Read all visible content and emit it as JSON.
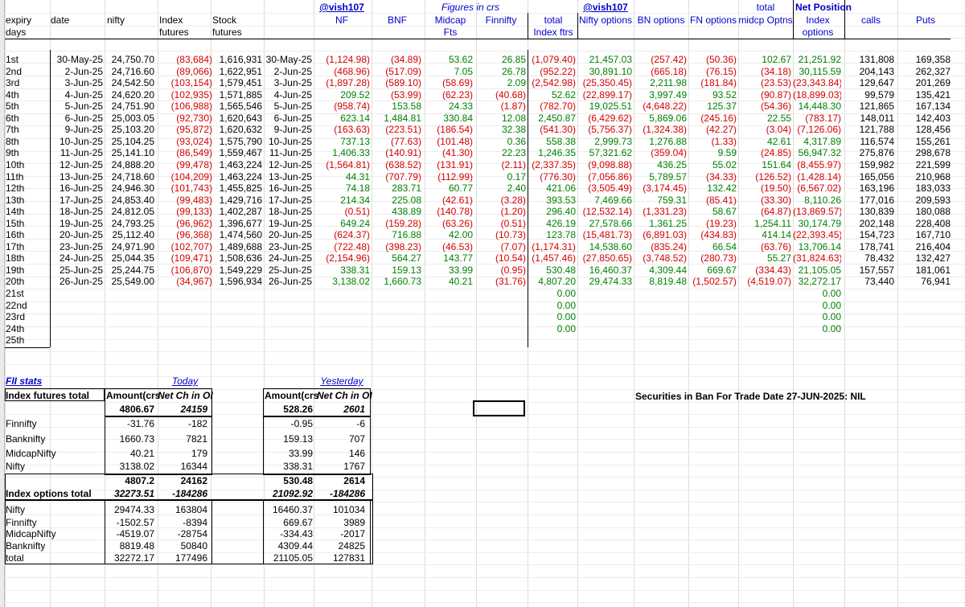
{
  "top_header": {
    "vish_left": "@vish107",
    "figures": "Figures in crs",
    "vish_right": "@vish107",
    "total_top": "total",
    "net_position": "Net Position"
  },
  "header_row": {
    "expiry": "expiry",
    "date": "date",
    "nifty": "nifty",
    "index_futures": "Index",
    "stock_futures": "Stock",
    "nf": "NF",
    "bnf": "BNF",
    "midcap": "Midcap",
    "finnifty": "Finnifty",
    "total": "total",
    "nifty_options": "Nifty options",
    "bn_options": "BN options",
    "fn_options": "FN options",
    "midcp_optns": "midcp Optns",
    "index": "Index",
    "calls": "calls",
    "puts": "Puts"
  },
  "header_row2": {
    "days": "days",
    "futures1": "futures",
    "futures2": "futures",
    "fts": "Fts",
    "index_ftrs": "Index ftrs",
    "options": "options"
  },
  "rows": [
    [
      "1st",
      "30-May-25",
      "24,750.70",
      "(83,684)",
      "1,616,931",
      "30-May-25",
      "(1,124.98)",
      "(34.89)",
      "53.62",
      "26.85",
      "(1,079.40)",
      "21,457.03",
      "(257.42)",
      "(50.36)",
      "102.67",
      "21,251.92",
      "131,808",
      "169,358"
    ],
    [
      "2nd",
      "2-Jun-25",
      "24,716.60",
      "(89,066)",
      "1,622,951",
      "2-Jun-25",
      "(468.96)",
      "(517.09)",
      "7.05",
      "26.78",
      "(952.22)",
      "30,891.10",
      "(665.18)",
      "(76.15)",
      "(34.18)",
      "30,115.59",
      "204,143",
      "262,327"
    ],
    [
      "3rd",
      "3-Jun-25",
      "24,542.50",
      "(103,154)",
      "1,579,451",
      "3-Jun-25",
      "(1,897.28)",
      "(589.10)",
      "(58.69)",
      "2.09",
      "(2,542.98)",
      "(25,350.45)",
      "2,211.98",
      "(181.84)",
      "(23.53)",
      "(23,343.84)",
      "129,647",
      "201,269"
    ],
    [
      "4th",
      "4-Jun-25",
      "24,620.20",
      "(102,935)",
      "1,571,885",
      "4-Jun-25",
      "209.52",
      "(53.99)",
      "(62.23)",
      "(40.68)",
      "52.62",
      "(22,899.17)",
      "3,997.49",
      "93.52",
      "(90.87)",
      "(18,899.03)",
      "99,579",
      "135,421"
    ],
    [
      "5th",
      "5-Jun-25",
      "24,751.90",
      "(106,988)",
      "1,565,546",
      "5-Jun-25",
      "(958.74)",
      "153.58",
      "24.33",
      "(1.87)",
      "(782.70)",
      "19,025.51",
      "(4,648.22)",
      "125.37",
      "(54.36)",
      "14,448.30",
      "121,865",
      "167,134"
    ],
    [
      "6th",
      "6-Jun-25",
      "25,003.05",
      "(92,730)",
      "1,620,643",
      "6-Jun-25",
      "623.14",
      "1,484.81",
      "330.84",
      "12.08",
      "2,450.87",
      "(6,429.62)",
      "5,869.06",
      "(245.16)",
      "22.55",
      "(783.17)",
      "148,011",
      "142,403"
    ],
    [
      "7th",
      "9-Jun-25",
      "25,103.20",
      "(95,872)",
      "1,620,632",
      "9-Jun-25",
      "(163.63)",
      "(223.51)",
      "(186.54)",
      "32.38",
      "(541.30)",
      "(5,756.37)",
      "(1,324.38)",
      "(42.27)",
      "(3.04)",
      "(7,126.06)",
      "121,788",
      "128,456"
    ],
    [
      "8th",
      "10-Jun-25",
      "25,104.25",
      "(93,024)",
      "1,575,790",
      "10-Jun-25",
      "737.13",
      "(77.63)",
      "(101.48)",
      "0.36",
      "558.38",
      "2,999.73",
      "1,276.88",
      "(1.33)",
      "42.61",
      "4,317.89",
      "116,574",
      "155,261"
    ],
    [
      "9th",
      "11-Jun-25",
      "25,141.10",
      "(86,549)",
      "1,559,467",
      "11-Jun-25",
      "1,406.33",
      "(140.91)",
      "(41.30)",
      "22.23",
      "1,246.35",
      "57,321.62",
      "(359.04)",
      "9.59",
      "(24.85)",
      "56,947.32",
      "275,876",
      "298,678"
    ],
    [
      "10th",
      "12-Jun-25",
      "24,888.20",
      "(99,478)",
      "1,463,224",
      "12-Jun-25",
      "(1,564.81)",
      "(638.52)",
      "(131.91)",
      "(2.11)",
      "(2,337.35)",
      "(9,098.88)",
      "436.25",
      "55.02",
      "151.64",
      "(8,455.97)",
      "159,982",
      "221,599"
    ],
    [
      "11th",
      "13-Jun-25",
      "24,718.60",
      "(104,209)",
      "1,463,224",
      "13-Jun-25",
      "44.31",
      "(707.79)",
      "(112.99)",
      "0.17",
      "(776.30)",
      "(7,056.86)",
      "5,789.57",
      "(34.33)",
      "(126.52)",
      "(1,428.14)",
      "165,056",
      "210,968"
    ],
    [
      "12th",
      "16-Jun-25",
      "24,946.30",
      "(101,743)",
      "1,455,825",
      "16-Jun-25",
      "74.18",
      "283.71",
      "60.77",
      "2.40",
      "421.06",
      "(3,505.49)",
      "(3,174.45)",
      "132.42",
      "(19.50)",
      "(6,567.02)",
      "163,196",
      "183,033"
    ],
    [
      "13th",
      "17-Jun-25",
      "24,853.40",
      "(99,483)",
      "1,429,716",
      "17-Jun-25",
      "214.34",
      "225.08",
      "(42.61)",
      "(3.28)",
      "393.53",
      "7,469.66",
      "759.31",
      "(85.41)",
      "(33.30)",
      "8,110.26",
      "177,016",
      "209,593"
    ],
    [
      "14th",
      "18-Jun-25",
      "24,812.05",
      "(99,133)",
      "1,402,287",
      "18-Jun-25",
      "(0.51)",
      "438.89",
      "(140.78)",
      "(1.20)",
      "296.40",
      "(12,532.14)",
      "(1,331.23)",
      "58.67",
      "(64.87)",
      "(13,869.57)",
      "130,839",
      "180,088"
    ],
    [
      "15th",
      "19-Jun-25",
      "24,793.25",
      "(96,962)",
      "1,396,677",
      "19-Jun-25",
      "649.24",
      "(159.28)",
      "(63.26)",
      "(0.51)",
      "426.19",
      "27,578.66",
      "1,361.25",
      "(19.23)",
      "1,254.11",
      "30,174.79",
      "202,148",
      "228,408"
    ],
    [
      "16th",
      "20-Jun-25",
      "25,112.40",
      "(96,368)",
      "1,474,560",
      "20-Jun-25",
      "(624.37)",
      "716.88",
      "42.00",
      "(10.73)",
      "123.78",
      "(15,481.73)",
      "(6,891.03)",
      "(434.83)",
      "414.14",
      "(22,393.45)",
      "154,723",
      "167,710"
    ],
    [
      "17th",
      "23-Jun-25",
      "24,971.90",
      "(102,707)",
      "1,489,688",
      "23-Jun-25",
      "(722.48)",
      "(398.23)",
      "(46.53)",
      "(7.07)",
      "(1,174.31)",
      "14,538.60",
      "(835.24)",
      "66.54",
      "(63.76)",
      "13,706.14",
      "178,741",
      "216,404"
    ],
    [
      "18th",
      "24-Jun-25",
      "25,044.35",
      "(109,471)",
      "1,508,636",
      "24-Jun-25",
      "(2,154.96)",
      "564.27",
      "143.77",
      "(10.54)",
      "(1,457.46)",
      "(27,850.65)",
      "(3,748.52)",
      "(280.73)",
      "55.27",
      "(31,824.63)",
      "78,432",
      "132,427"
    ],
    [
      "19th",
      "25-Jun-25",
      "25,244.75",
      "(106,870)",
      "1,549,229",
      "25-Jun-25",
      "338.31",
      "159.13",
      "33.99",
      "(0.95)",
      "530.48",
      "16,460.37",
      "4,309.44",
      "669.67",
      "(334.43)",
      "21,105.05",
      "157,557",
      "181,061"
    ],
    [
      "20th",
      "26-Jun-25",
      "25,549.00",
      "(34,967)",
      "1,596,934",
      "26-Jun-25",
      "3,138.02",
      "1,660.73",
      "40.21",
      "(31.76)",
      "4,807.20",
      "29,474.33",
      "8,819.48",
      "(1,502.57)",
      "(4,519.07)",
      "32,272.17",
      "73,440",
      "76,941"
    ]
  ],
  "empty_rows": [
    {
      "label": "21st",
      "total": "0.00",
      "net": "0.00"
    },
    {
      "label": "22nd",
      "total": "0.00",
      "net": "0.00"
    },
    {
      "label": "23rd",
      "total": "0.00",
      "net": "0.00"
    },
    {
      "label": "24th",
      "total": "0.00",
      "net": "0.00"
    },
    {
      "label": "25th",
      "total": "",
      "net": ""
    }
  ],
  "stats": {
    "fii_stats": "FII stats",
    "today": "Today",
    "yesterday": "Yesterday",
    "index_futures_total": "Index futures total",
    "amount_crs": "Amount(crs",
    "net_ch_oi": "Net Ch in OI",
    "amount_crs_y": "Amount(crs",
    "net_ch_oi_y": "Net Ch in OI",
    "futures_total": {
      "t_amt": "4806.67",
      "t_oi": "24159",
      "y_amt": "528.26",
      "y_oi": "2601"
    },
    "futures_rows": [
      {
        "name": "Finnifty",
        "t_amt": "-31.76",
        "t_oi": "-182",
        "y_amt": "-0.95",
        "y_oi": "-6"
      },
      {
        "name": "Banknifty",
        "t_amt": "1660.73",
        "t_oi": "7821",
        "y_amt": "159.13",
        "y_oi": "707"
      },
      {
        "name": "MidcapNifty",
        "t_amt": "40.21",
        "t_oi": "179",
        "y_amt": "33.99",
        "y_oi": "146"
      },
      {
        "name": "Nifty",
        "t_amt": "3138.02",
        "t_oi": "16344",
        "y_amt": "338.31",
        "y_oi": "1767"
      }
    ],
    "futures_sum": {
      "t_amt": "4807.2",
      "t_oi": "24162",
      "y_amt": "530.48",
      "y_oi": "2614"
    },
    "index_options_total": "Index options total",
    "options_total": {
      "t_amt": "32273.51",
      "t_oi": "-184286",
      "y_amt": "21092.92",
      "y_oi": "-184286"
    },
    "options_rows": [
      {
        "name": "Nifty",
        "t_amt": "29474.33",
        "t_oi": "163804",
        "y_amt": "16460.37",
        "y_oi": "101034"
      },
      {
        "name": "Finnifty",
        "t_amt": "-1502.57",
        "t_oi": "-8394",
        "y_amt": "669.67",
        "y_oi": "3989"
      },
      {
        "name": "MidcapNifty",
        "t_amt": "-4519.07",
        "t_oi": "-28754",
        "y_amt": "-334.43",
        "y_oi": "-2017"
      },
      {
        "name": "Banknifty",
        "t_amt": "8819.48",
        "t_oi": "50840",
        "y_amt": "4309.44",
        "y_oi": "24825"
      },
      {
        "name": "total",
        "t_amt": "32272.17",
        "t_oi": "177496",
        "y_amt": "21105.05",
        "y_oi": "127831"
      }
    ]
  },
  "ban_notice": "Securities in Ban For Trade Date 27-JUN-2025: NIL"
}
